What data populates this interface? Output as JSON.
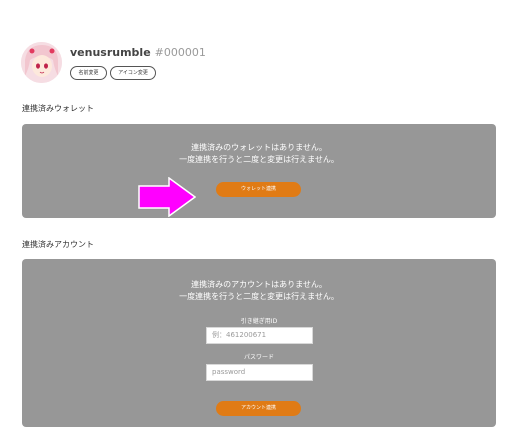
{
  "profile": {
    "username": "venusrumble",
    "user_id": "#000001",
    "rename_button": "名前変更",
    "icon_button": "アイコン変更"
  },
  "wallet_section": {
    "title": "連携済みウォレット",
    "message_line1": "連携済みのウォレットはありません。",
    "message_line2": "一度連携を行うと二度と変更は行えません。",
    "button_label": "ウォレット連携"
  },
  "account_section": {
    "title": "連携済みアカウント",
    "message_line1": "連携済みのアカウントはありません。",
    "message_line2": "一度連携を行うと二度と変更は行えません。",
    "id_label": "引き継ぎ用ID",
    "id_placeholder": "例：461200671",
    "password_label": "パスワード",
    "password_placeholder": "password",
    "button_label": "アカウント連携"
  },
  "colors": {
    "panel": "#979797",
    "accent": "#e07b15",
    "arrow": "#ff00ff"
  }
}
